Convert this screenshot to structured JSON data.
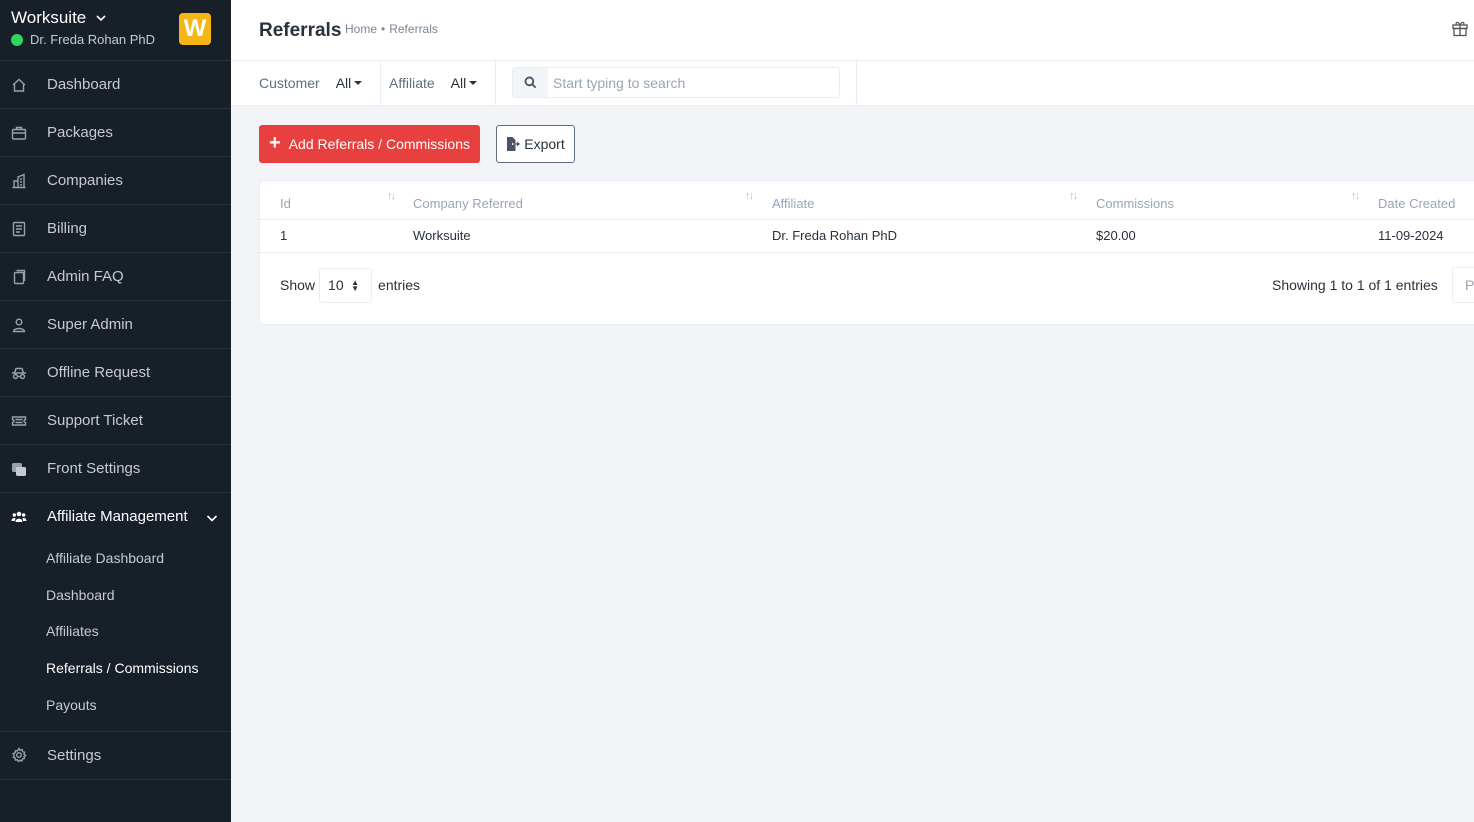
{
  "brand": {
    "name": "Worksuite",
    "user": "Dr. Freda Rohan PhD",
    "logo_letter": "W",
    "logo_color": "#f5b517",
    "status_color": "#2fd55d"
  },
  "sidebar": {
    "items": [
      {
        "label": "Dashboard",
        "icon": "house-icon"
      },
      {
        "label": "Packages",
        "icon": "briefcase-icon"
      },
      {
        "label": "Companies",
        "icon": "building-icon"
      },
      {
        "label": "Billing",
        "icon": "receipt-icon"
      },
      {
        "label": "Admin FAQ",
        "icon": "document-icon"
      },
      {
        "label": "Super Admin",
        "icon": "person-icon"
      },
      {
        "label": "Offline Request",
        "icon": "incognito-icon"
      },
      {
        "label": "Support Ticket",
        "icon": "ticket-icon"
      },
      {
        "label": "Front Settings",
        "icon": "layers-icon"
      },
      {
        "label": "Affiliate Management",
        "icon": "people-icon"
      },
      {
        "label": "Settings",
        "icon": "gear-icon"
      }
    ],
    "submenu": [
      {
        "label": "Affiliate Dashboard"
      },
      {
        "label": "Dashboard"
      },
      {
        "label": "Affiliates"
      },
      {
        "label": "Referrals / Commissions"
      },
      {
        "label": "Payouts"
      }
    ]
  },
  "header": {
    "title": "Referrals",
    "breadcrumb_home": "Home",
    "breadcrumb_sep": "•",
    "breadcrumb_current": "Referrals"
  },
  "filters": {
    "customer_label": "Customer",
    "customer_value": "All",
    "affiliate_label": "Affiliate",
    "affiliate_value": "All",
    "search_placeholder": "Start typing to search"
  },
  "actions": {
    "add_label": "Add Referrals / Commissions",
    "add_color": "#e8403f",
    "export_label": "Export"
  },
  "table": {
    "columns": [
      "Id",
      "Company Referred",
      "Affiliate",
      "Commissions",
      "Date Created"
    ],
    "rows": [
      {
        "id": "1",
        "company": "Worksuite",
        "affiliate": "Dr. Freda Rohan PhD",
        "commission": "$20.00",
        "date": "11-09-2024"
      }
    ],
    "show_label": "Show",
    "page_size": "10",
    "entries_label": "entries",
    "info": "Showing 1 to 1 of 1 entries",
    "prev_label": "Pr"
  }
}
